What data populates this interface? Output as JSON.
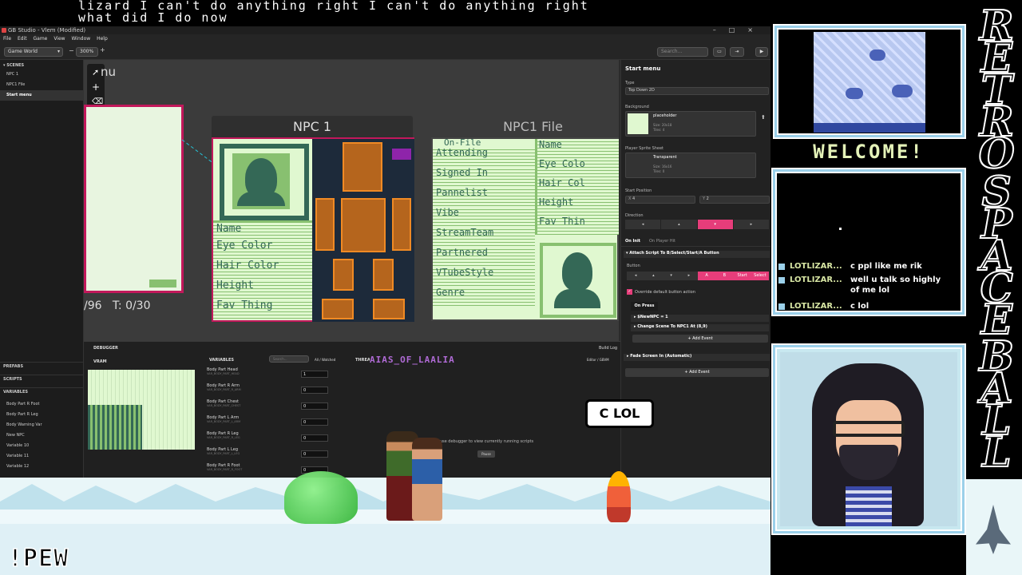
{
  "stream": {
    "caption_line1": "lizard I can't do anything right I can't do anything right",
    "caption_line2": "what did I do now",
    "welcome": "WELCOME!",
    "speech_bubble": "C LOL",
    "pew": "!PEW",
    "side_letters": [
      "R",
      "E",
      "T",
      "R",
      "O",
      "S",
      "P",
      "A",
      "C",
      "E",
      "B",
      "A",
      "L",
      "L"
    ],
    "chat": [
      {
        "user": "LOTLIZAR...",
        "message": "c ppl like me rik"
      },
      {
        "user": "LOTLIZAR...",
        "message": "well u talk so highly of me lol"
      },
      {
        "user": "LOTLIZAR...",
        "message": "c lol"
      }
    ],
    "fighter_name": "AIAS_OF_LAALIA"
  },
  "app": {
    "window_title": "GB Studio - Vlem (Modified)",
    "window_controls": [
      "–",
      "□",
      "×"
    ],
    "menu": [
      "File",
      "Edit",
      "Game",
      "View",
      "Window",
      "Help"
    ],
    "toolbar": {
      "view_select": "Game World",
      "zoom": "300%",
      "search_placeholder": "Search..."
    },
    "left": {
      "scenes_header": "SCENES",
      "scenes": [
        "NPC 1",
        "NPC1 File",
        "Start menu"
      ],
      "prefabs_header": "PREFABS",
      "scripts_header": "SCRIPTS",
      "variables_header": "VARIABLES",
      "variables": [
        "Body Part R Foot",
        "Body Part R Leg",
        "Body Warning Var",
        "New NPC",
        "Variable 10",
        "Variable 11",
        "Variable 12"
      ]
    },
    "canvas": {
      "start_menu_label": "nu",
      "start_menu_footer": "/96   T: 0/30",
      "npc1_title": "NPC 1",
      "npc1_file_title": "NPC1 File",
      "npc1_fields": [
        "Name",
        "Eye Color",
        "Hair Color",
        "Height",
        "Fav Thing"
      ],
      "file_header": "On-File",
      "file_fields_left": [
        "Attending",
        "Signed In",
        "Pannelist",
        "Vibe",
        "StreamTeam",
        "Partnered",
        "VTubeStyle",
        "Genre"
      ],
      "file_fields_right": [
        "Name",
        "Eye Colo",
        "Hair Col",
        "Height",
        "Fav Thin"
      ]
    },
    "right": {
      "title": "Start menu",
      "type_label": "Type",
      "type_value": "Top Down 2D",
      "background_label": "Background",
      "background_name": "placeholder",
      "background_size": "Size: 20x18",
      "background_tiles": "Tiles: 4",
      "sprite_label": "Player Sprite Sheet",
      "sprite_name": "Transparent",
      "sprite_size": "Size: 16x16",
      "sprite_tiles": "Tiles: 0",
      "start_pos_label": "Start Position",
      "start_x_label": "X",
      "start_x": "4",
      "start_y_label": "Y",
      "start_y": "2",
      "direction_label": "Direction",
      "tab_init": "On Init",
      "tab_hit": "On Player Hit",
      "event_attach": "Attach Script To B/Select/Start/A Button",
      "button_label": "Button",
      "buttons": [
        "A",
        "B",
        "Start",
        "Select"
      ],
      "override_label": "Override default button action",
      "on_press": "On Press",
      "event_set": "$NewNPC = 1",
      "event_change": "Change Scene To NPC1 At (8,9)",
      "add_event": "Add Event",
      "event_fade": "Fade Screen In (Automatic)",
      "add_event2": "Add Event"
    },
    "debugger": {
      "title": "DEBUGGER",
      "vram": "VRAM",
      "variables": "VARIABLES",
      "search_placeholder": "Search...",
      "filter": "All / Watched",
      "threads": "THREADS",
      "editor_tab": "Editor / GBVM",
      "build_log": "Build Log",
      "pause_msg": "Pause debugger to view currently running scripts",
      "pause_btn": "Pause",
      "rows": [
        {
          "name": "Body Part Head",
          "sub": "VAR_BODY_PART_HEAD",
          "value": "1"
        },
        {
          "name": "Body Part R Arm",
          "sub": "VAR_BODY_PART_R_ARM",
          "value": "0"
        },
        {
          "name": "Body Part Chest",
          "sub": "VAR_BODY_PART_CHEST",
          "value": "0"
        },
        {
          "name": "Body Part L Arm",
          "sub": "VAR_BODY_PART_L_ARM",
          "value": "0"
        },
        {
          "name": "Body Part R Leg",
          "sub": "VAR_BODY_PART_R_LEG",
          "value": "0"
        },
        {
          "name": "Body Part L Leg",
          "sub": "VAR_BODY_PART_L_LEG",
          "value": "0"
        },
        {
          "name": "Body Part R Foot",
          "sub": "VAR_BODY_PART_R_FOOT",
          "value": "0"
        }
      ]
    }
  }
}
